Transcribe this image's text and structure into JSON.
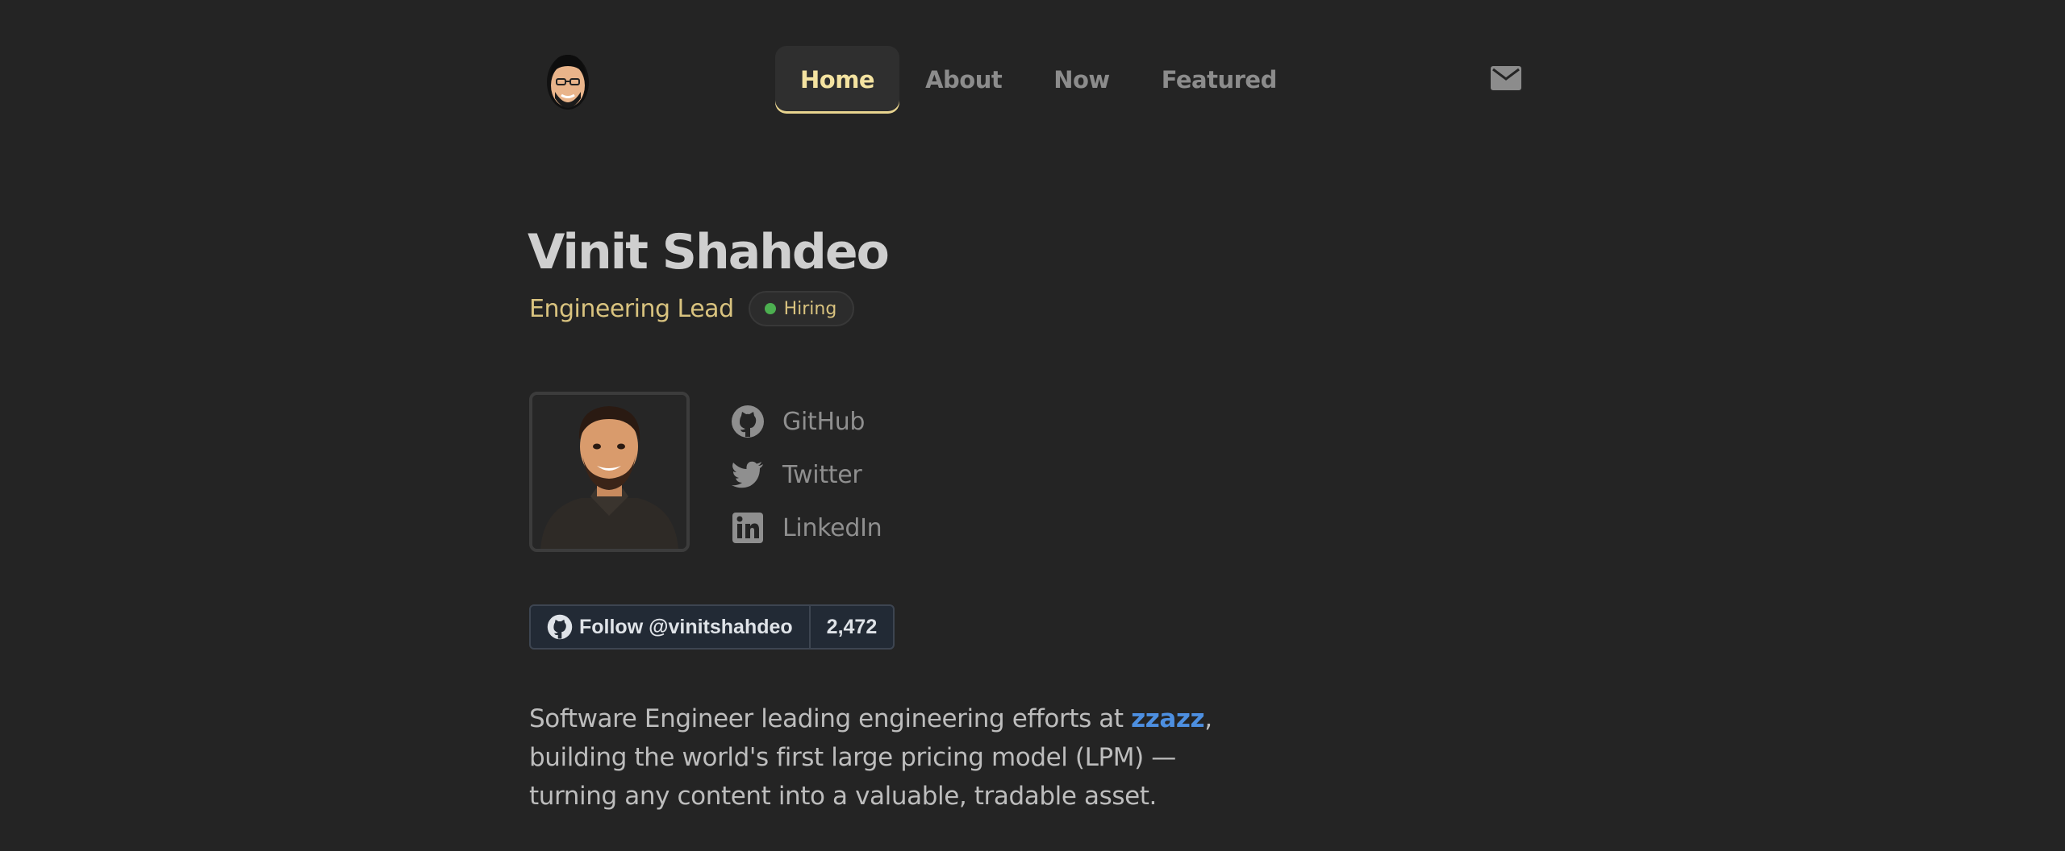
{
  "header": {
    "nav": [
      {
        "label": "Home",
        "active": true
      },
      {
        "label": "About",
        "active": false
      },
      {
        "label": "Now",
        "active": false
      },
      {
        "label": "Featured",
        "active": false
      }
    ],
    "logo_icon": "cartoon-face-icon",
    "mail_icon": "mail-icon"
  },
  "hero": {
    "name": "Vinit Shahdeo",
    "role": "Engineering Lead",
    "badge": {
      "label": "Hiring",
      "dot_color": "#4caf50"
    }
  },
  "socials": [
    {
      "label": "GitHub",
      "icon": "github-icon"
    },
    {
      "label": "Twitter",
      "icon": "twitter-icon"
    },
    {
      "label": "LinkedIn",
      "icon": "linkedin-icon"
    }
  ],
  "follow": {
    "label": "Follow @vinitshahdeo",
    "count": "2,472"
  },
  "bio": {
    "before": "Software Engineer leading engineering efforts at ",
    "link": "zzazz",
    "after": ", building the world's first large pricing model (LPM) — turning any content into a valuable, tradable asset."
  },
  "colors": {
    "background": "#242424",
    "accent": "#f4e3a1",
    "role": "#d9c37f",
    "link": "#4d8fe0"
  }
}
